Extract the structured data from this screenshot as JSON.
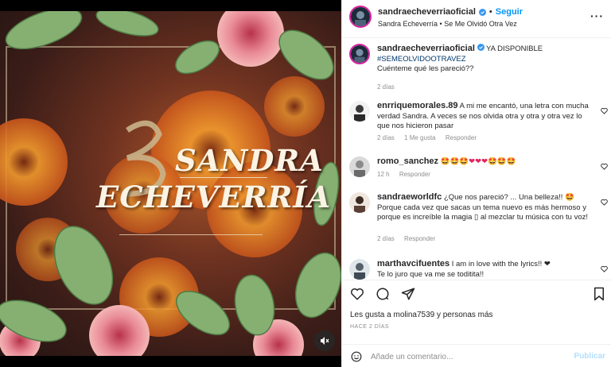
{
  "post": {
    "username": "sandraecheverriaoficial",
    "follow_label": "Seguir",
    "separator": "•",
    "audio": "Sandra Echeverría • Se Me Olvidó Otra Vez",
    "more_icon": "more-options-icon"
  },
  "media": {
    "brand_line1": "SANDRA",
    "brand_line2": "ECHEVERRÍA",
    "mute_icon": "muted-speaker-icon",
    "colors": {
      "accent_red": "#c3302e",
      "flower_orange": "#e88a2e",
      "leaf_green": "#7fa66a"
    }
  },
  "caption": {
    "username": "sandraecheverriaoficial",
    "text": "YA DISPONIBLE",
    "hashtag": "#SEMEOLVIDOOTRAVEZ",
    "line2": "Cuénteme qué les pareció??",
    "time": "2 días"
  },
  "comments": [
    {
      "username": "enrriquemorales.89",
      "text": "A mi me encantó, una letra con mucha verdad Sandra. A veces se nos olvida otra y otra y otra vez lo que nos hicieron pasar",
      "time": "2 días",
      "likes": "1 Me gusta",
      "reply": "Responder"
    },
    {
      "username": "romo_sanchez",
      "text": "🤩🤩🤩❤❤❤🤩🤩🤩",
      "time": "12 h",
      "reply": "Responder"
    },
    {
      "username": "sandraeworldfc",
      "text": "¿Que nos pareció? ... Una belleza!! 🤩 Porque cada vez que sacas un tema nuevo es más hermoso y porque es increíble la magia ▯ al mezclar tu música con tu voz!",
      "time": "2 días",
      "reply": "Responder"
    },
    {
      "username": "marthavcifuentes",
      "text": "I am in love with the lyrics!! ❤",
      "line2": "Te lo juro que va me se toditita!!"
    }
  ],
  "actions": {
    "likes_text": "Les gusta a molina7539 y personas más",
    "posted_ago": "HACE 2 DÍAS",
    "comment_placeholder": "Añade un comentario...",
    "publish_label": "Publicar"
  }
}
